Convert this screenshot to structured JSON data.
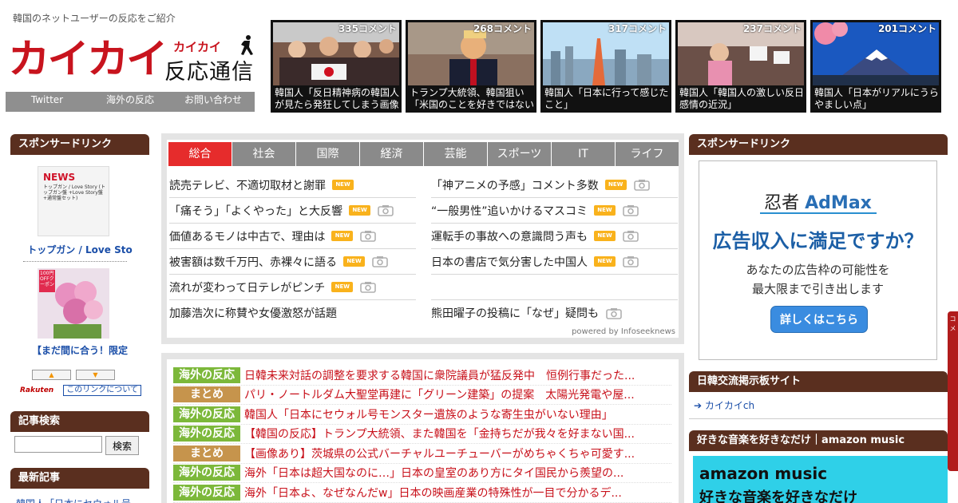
{
  "header": {
    "tagline": "韓国のネットユーザーの反応をご紹介",
    "logo_main": "カイカイ",
    "logo_kana": "カイカイ",
    "logo_sub": "反応通信",
    "nav": [
      "Twitter",
      "海外の反応",
      "お問い合わせ"
    ]
  },
  "featured": [
    {
      "count": "335コメント",
      "title": "韓国人「反日精神病の韓国人が見たら発狂してしまう画像"
    },
    {
      "count": "268コメント",
      "title": "トランプ大統領、韓国狙い「米国のことを好きではない"
    },
    {
      "count": "317コメント",
      "title": "韓国人「日本に行って感じたこと」"
    },
    {
      "count": "237コメント",
      "title": "韓国人「韓国人の激しい反日感情の近況」"
    },
    {
      "count": "201コメント",
      "title": "韓国人「日本がリアルにうらやましい点」"
    }
  ],
  "left": {
    "sponsor_title": "スポンサードリンク",
    "ad1_news": "NEWS",
    "ad1_small": "トップガン / Love Story (トップガン盤 +Love Story盤 +通常盤セット)",
    "ad1_link": "トップガン / Love Sto",
    "ad2_tag": "100円OFFクーポン",
    "ad2_link": "【まだ間に合う！限定",
    "arrow_up": "▲",
    "arrow_down": "▼",
    "rakuten": "Rakuten",
    "rakuten_link": "このリンクについて",
    "search_title": "記事検索",
    "search_value": "",
    "search_button": "検索",
    "latest_title": "最新記事",
    "latest_first": "韓国人「日本にセウォル号"
  },
  "news": {
    "tabs": [
      "総合",
      "社会",
      "国際",
      "経済",
      "芸能",
      "スポーツ",
      "IT",
      "ライフ"
    ],
    "active_tab": 0,
    "left": [
      {
        "title": "読売テレビ、不適切取材と謝罪",
        "new": true,
        "cam": false
      },
      {
        "title": "「痛そう」「よくやった」と大反響",
        "new": true,
        "cam": true
      },
      {
        "title": "価値あるモノは中古で、理由は",
        "new": true,
        "cam": true
      },
      {
        "title": "被害額は数千万円、赤裸々に語る",
        "new": true,
        "cam": true
      },
      {
        "title": "流れが変わって日テレがピンチ",
        "new": true,
        "cam": true
      },
      {
        "title": "加藤浩次に称賛や女優激怒が話題",
        "new": false,
        "cam": false
      }
    ],
    "right": [
      {
        "title": "「神アニメの予感」コメント多数",
        "new": true,
        "cam": true
      },
      {
        "title": "“一般男性”追いかけるマスコミ",
        "new": true,
        "cam": true
      },
      {
        "title": "運転手の事故への意識問う声も",
        "new": true,
        "cam": true
      },
      {
        "title": "日本の書店で気分害した中国人",
        "new": true,
        "cam": true
      },
      {
        "title": "",
        "new": false,
        "cam": false
      },
      {
        "title": "熊田曜子の投稿に「なぜ」疑問も",
        "new": false,
        "cam": true
      }
    ],
    "new_label": "NEW",
    "powered": "powered by Infoseeknews"
  },
  "articles": [
    {
      "cat": "海外の反応",
      "type": "kaigai",
      "title": "日韓未来対話の調整を要求する韓国に衆院議員が猛反発中　恒例行事だった..."
    },
    {
      "cat": "まとめ",
      "type": "matome",
      "title": "パリ・ノートルダム大聖堂再建に「グリーン建築」の提案　太陽光発電や屋..."
    },
    {
      "cat": "海外の反応",
      "type": "kaigai",
      "title": "韓国人「日本にセウォル号モンスター遺族のような寄生虫がいない理由」"
    },
    {
      "cat": "海外の反応",
      "type": "kaigai",
      "title": "【韓国の反応】トランプ大統領、また韓国を「金持ちだが我々を好まない国..."
    },
    {
      "cat": "まとめ",
      "type": "matome",
      "title": "【画像あり】茨城県の公式バーチャルユーチューバーがめちゃくちゃ可愛す..."
    },
    {
      "cat": "海外の反応",
      "type": "kaigai",
      "title": "海外「日本は超大国なのに…」日本の皇室のあり方にタイ国民から羨望の..."
    },
    {
      "cat": "海外の反応",
      "type": "kaigai",
      "title": "海外「日本よ、なぜなんだw」日本の映画産業の特殊性が一目で分かるデ..."
    }
  ],
  "right": {
    "sponsor_title": "スポンサードリンク",
    "ninja_logo_a": "忍者",
    "ninja_logo_b": "AdMax",
    "ninja_big": "広告収入に満足ですか？",
    "ninja_sub1": "あなたの広告枠の可能性を",
    "ninja_sub2": "最大限まで引き出します",
    "ninja_btn": "詳しくはこちら",
    "bbs_title": "日韓交流掲示板サイト",
    "bbs_link": "カイカイch",
    "music_title": "好きな音楽を好きなだけ｜amazon music",
    "music_logo": "amazon music",
    "music_text": "好きな音楽を好きなだけ"
  },
  "side_tab": "コメ"
}
